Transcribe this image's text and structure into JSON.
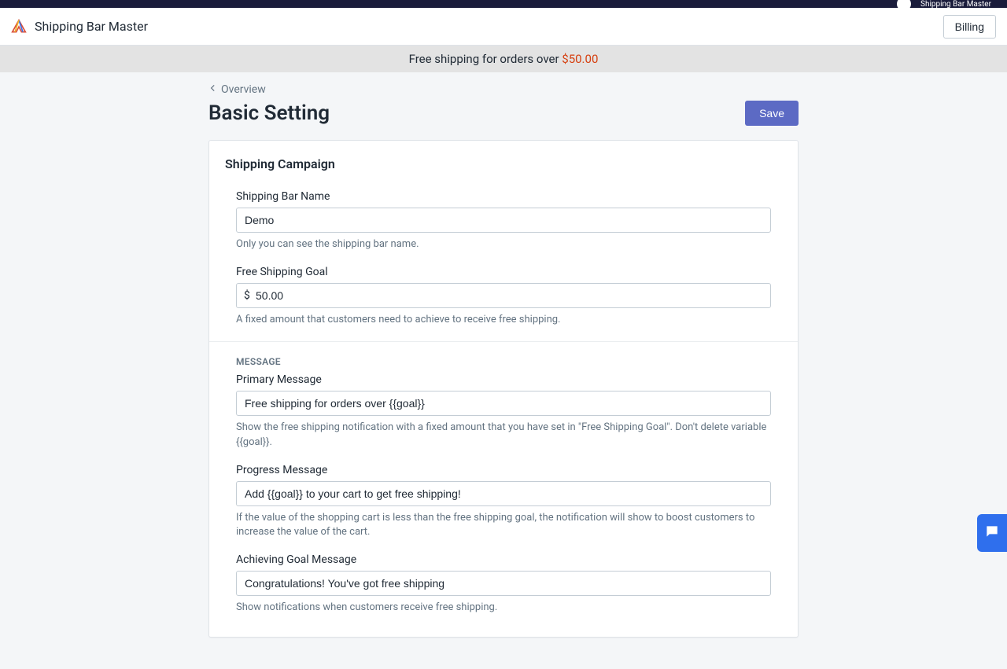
{
  "topbar": {
    "partial_text": "Shipping Bar Master"
  },
  "header": {
    "app_title": "Shipping Bar Master",
    "billing_label": "Billing"
  },
  "promo": {
    "prefix": "Free shipping for orders over ",
    "price": "$50.00"
  },
  "breadcrumb": {
    "label": "Overview"
  },
  "page": {
    "title": "Basic Setting",
    "save_label": "Save"
  },
  "card": {
    "title": "Shipping Campaign"
  },
  "fields": {
    "shipping_bar_name": {
      "label": "Shipping Bar Name",
      "value": "Demo",
      "help": "Only you can see the shipping bar name."
    },
    "free_shipping_goal": {
      "label": "Free Shipping Goal",
      "currency": "$",
      "value": "50.00",
      "help": "A fixed amount that customers need to achieve to receive free shipping."
    },
    "message_section": "MESSAGE",
    "primary_message": {
      "label": "Primary Message",
      "value": "Free shipping for orders over {{goal}}",
      "help": "Show the free shipping notification with a fixed amount that you have set in \"Free Shipping Goal\". Don't delete variable {{goal}}."
    },
    "progress_message": {
      "label": "Progress Message",
      "value": "Add {{goal}} to your cart to get free shipping!",
      "help": "If the value of the shopping cart is less than the free shipping goal, the notification will show to boost customers to increase the value of the cart."
    },
    "achieving_message": {
      "label": "Achieving Goal Message",
      "value": "Congratulations! You've got free shipping",
      "help": "Show notifications when customers receive free shipping."
    }
  }
}
